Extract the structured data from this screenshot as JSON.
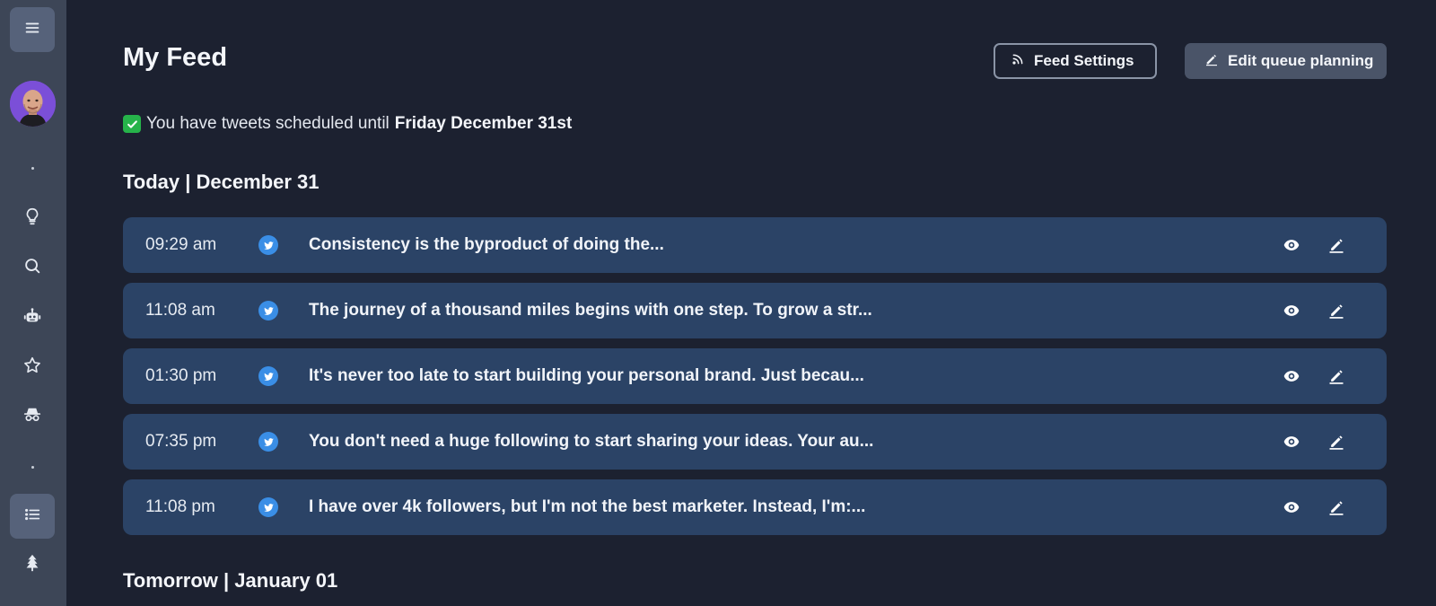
{
  "sidebar": {
    "menu_icon": "menu-icon",
    "avatar_icon": "avatar",
    "items": [
      {
        "icon": "lightbulb-icon"
      },
      {
        "icon": "search-icon"
      },
      {
        "icon": "robot-icon"
      },
      {
        "icon": "star-icon"
      },
      {
        "icon": "incognito-icon"
      },
      {
        "icon": "list-icon",
        "active": true
      },
      {
        "icon": "tree-icon"
      }
    ]
  },
  "header": {
    "title": "My Feed",
    "feed_settings_label": "Feed Settings",
    "edit_queue_label": "Edit queue planning"
  },
  "status": {
    "prefix": "You have tweets scheduled until",
    "until": "Friday December 31st"
  },
  "days": [
    {
      "heading": "Today | December 31",
      "tweets": [
        {
          "time": "09:29 am",
          "text": "Consistency is the byproduct of doing the..."
        },
        {
          "time": "11:08 am",
          "text": "The journey of a thousand miles begins with one step. To grow a str..."
        },
        {
          "time": "01:30 pm",
          "text": "It's never too late to start building your personal brand. Just becau..."
        },
        {
          "time": "07:35 pm",
          "text": "You don't need a huge following to start sharing your ideas. Your au..."
        },
        {
          "time": "11:08 pm",
          "text": "I have over 4k followers, but I'm not the best marketer. Instead, I'm:..."
        }
      ]
    },
    {
      "heading": "Tomorrow | January 01",
      "tweets": []
    }
  ],
  "colors": {
    "background": "#1c2130",
    "sidebar": "#3d4657",
    "row": "#2b4366",
    "twitter": "#3a8ee6",
    "check": "#26b34a"
  }
}
